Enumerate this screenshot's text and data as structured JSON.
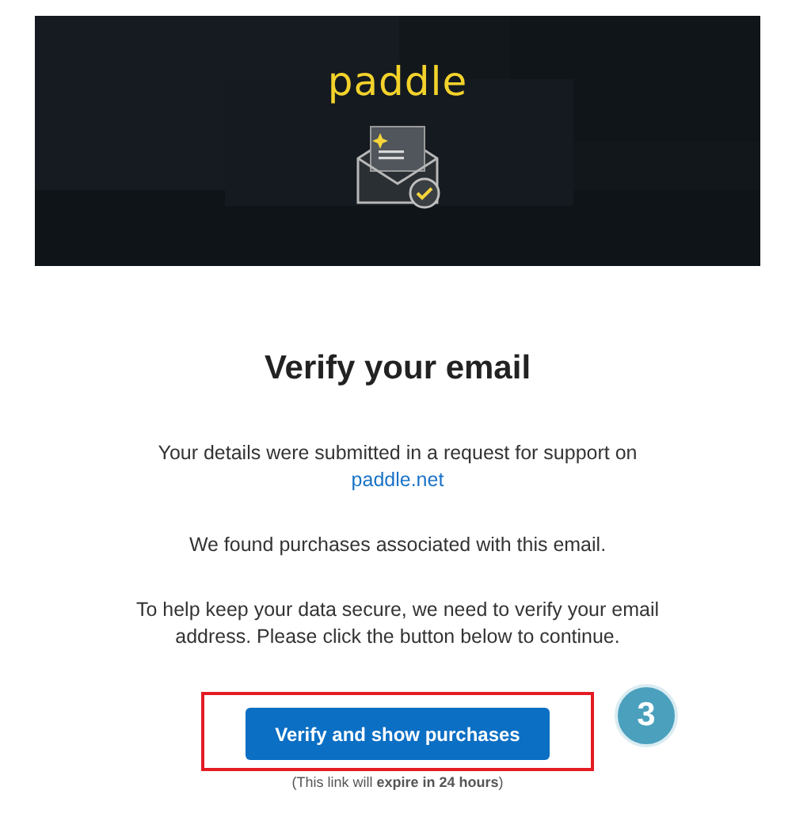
{
  "header": {
    "logo": "paddle"
  },
  "title": "Verify your email",
  "paragraphs": [
    {
      "text": "Your details were submitted in a request for support on",
      "link": "paddle.net"
    },
    {
      "text": "We found purchases associated with this email."
    },
    {
      "text": "To help keep your data secure, we need to verify your email address. Please click the button below to continue."
    }
  ],
  "button": {
    "label": "Verify and show purchases"
  },
  "footnote": "(This link will **expire in 24 hours**)",
  "step_badge": "3"
}
